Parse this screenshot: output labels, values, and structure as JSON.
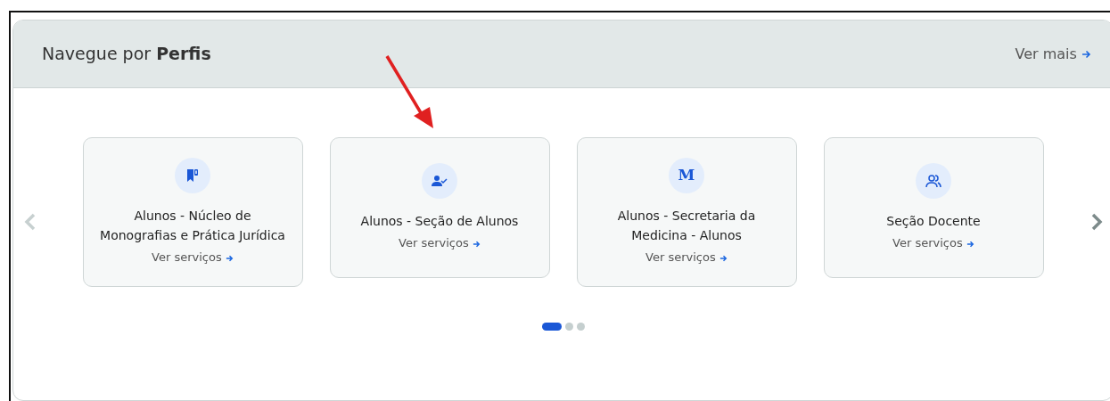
{
  "header": {
    "title": "Navegue por **Perfis**",
    "more_link": "Ver mais"
  },
  "cards": [
    {
      "title": "Alunos - Núcleo de Monografias e Prática Jurídica",
      "link": "Ver serviços"
    },
    {
      "title": "Alunos - Seção de Alunos",
      "link": "Ver serviços"
    },
    {
      "title": "Alunos - Secretaria da Medicina - Alunos",
      "link": "Ver serviços",
      "icon_letter": "M"
    },
    {
      "title": "Seção Docente",
      "link": "Ver serviços"
    }
  ],
  "carousel_dots": [
    {
      "selected": true
    },
    {
      "selected": false
    },
    {
      "selected": false
    }
  ]
}
